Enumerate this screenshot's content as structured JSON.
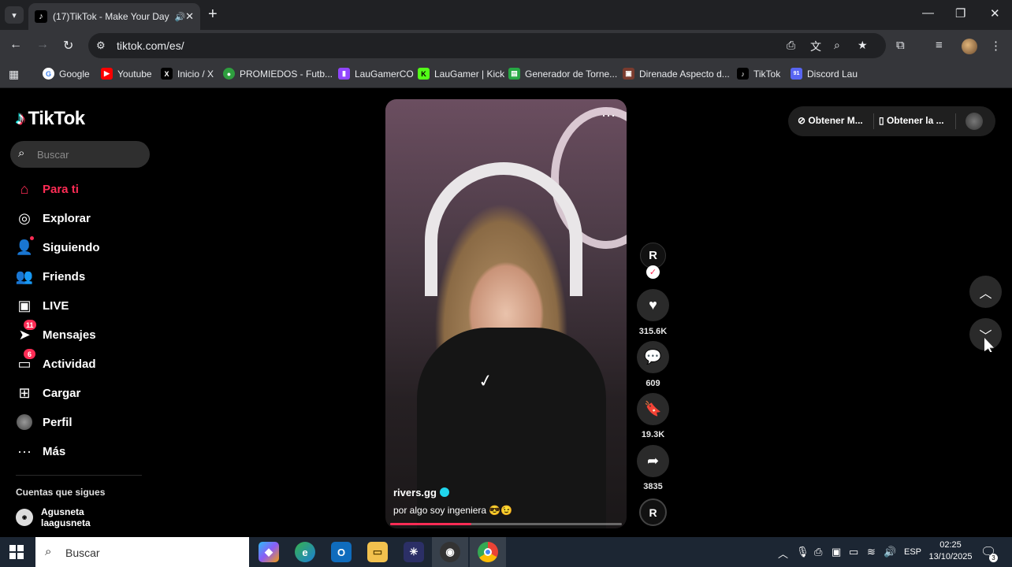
{
  "browser": {
    "tab": {
      "title": "(17)TikTok - Make Your Day",
      "favicon_icon": "tiktok-icon",
      "audio_icon": "speaker-icon"
    },
    "url": "tiktok.com/es/",
    "bookmarks": [
      {
        "label": "Google",
        "icon": "google-icon",
        "color": "#ffffff"
      },
      {
        "label": "Youtube",
        "icon": "youtube-icon",
        "color": "#ff0000"
      },
      {
        "label": "Inicio / X",
        "icon": "x-icon",
        "color": "#000000"
      },
      {
        "label": "PROMIEDOS - Futb...",
        "icon": "promiedos-icon",
        "color": "#2e9e3e"
      },
      {
        "label": "LauGamerCO",
        "icon": "twitch-icon",
        "color": "#9146ff"
      },
      {
        "label": "LauGamer | Kick",
        "icon": "kick-icon",
        "color": "#53fc18"
      },
      {
        "label": "Generador de Torne...",
        "icon": "bracket-icon",
        "color": "#27a844"
      },
      {
        "label": "Direnade Aspecto d...",
        "icon": "aspect-icon",
        "color": "#7a3b2e"
      },
      {
        "label": "TikTok",
        "icon": "tiktok-icon",
        "color": "#000000"
      },
      {
        "label": "Discord Lau",
        "icon": "discord-icon",
        "color": "#5865f2"
      }
    ],
    "discord_badge": "91"
  },
  "sidebar": {
    "logo": "TikTok",
    "search_placeholder": "Buscar",
    "items": [
      {
        "label": "Para ti",
        "icon": "home-icon",
        "active": true
      },
      {
        "label": "Explorar",
        "icon": "compass-icon"
      },
      {
        "label": "Siguiendo",
        "icon": "following-icon"
      },
      {
        "label": "Friends",
        "icon": "friends-icon"
      },
      {
        "label": "LIVE",
        "icon": "live-icon"
      },
      {
        "label": "Mensajes",
        "icon": "messages-icon",
        "badge": "11"
      },
      {
        "label": "Actividad",
        "icon": "activity-icon",
        "badge": "6"
      },
      {
        "label": "Cargar",
        "icon": "upload-icon"
      },
      {
        "label": "Perfil",
        "icon": "profile-icon"
      },
      {
        "label": "Más",
        "icon": "more-icon"
      }
    ],
    "following_title": "Cuentas que sigues",
    "following": [
      {
        "name": "Agusneta",
        "handle": "laagusneta"
      }
    ]
  },
  "video": {
    "username": "rivers.gg",
    "caption": "por algo soy ingeniera 😎😉",
    "progress": 0.35,
    "likes": "315.6K",
    "comments": "609",
    "saves": "19.3K",
    "shares": "3835"
  },
  "top_pill": {
    "item1": "Obtener M...",
    "item2": "Obtener la ..."
  },
  "taskbar": {
    "search": "Buscar",
    "lang": "ESP",
    "time": "02:25",
    "date": "13/10/2025",
    "notifications": "3"
  }
}
